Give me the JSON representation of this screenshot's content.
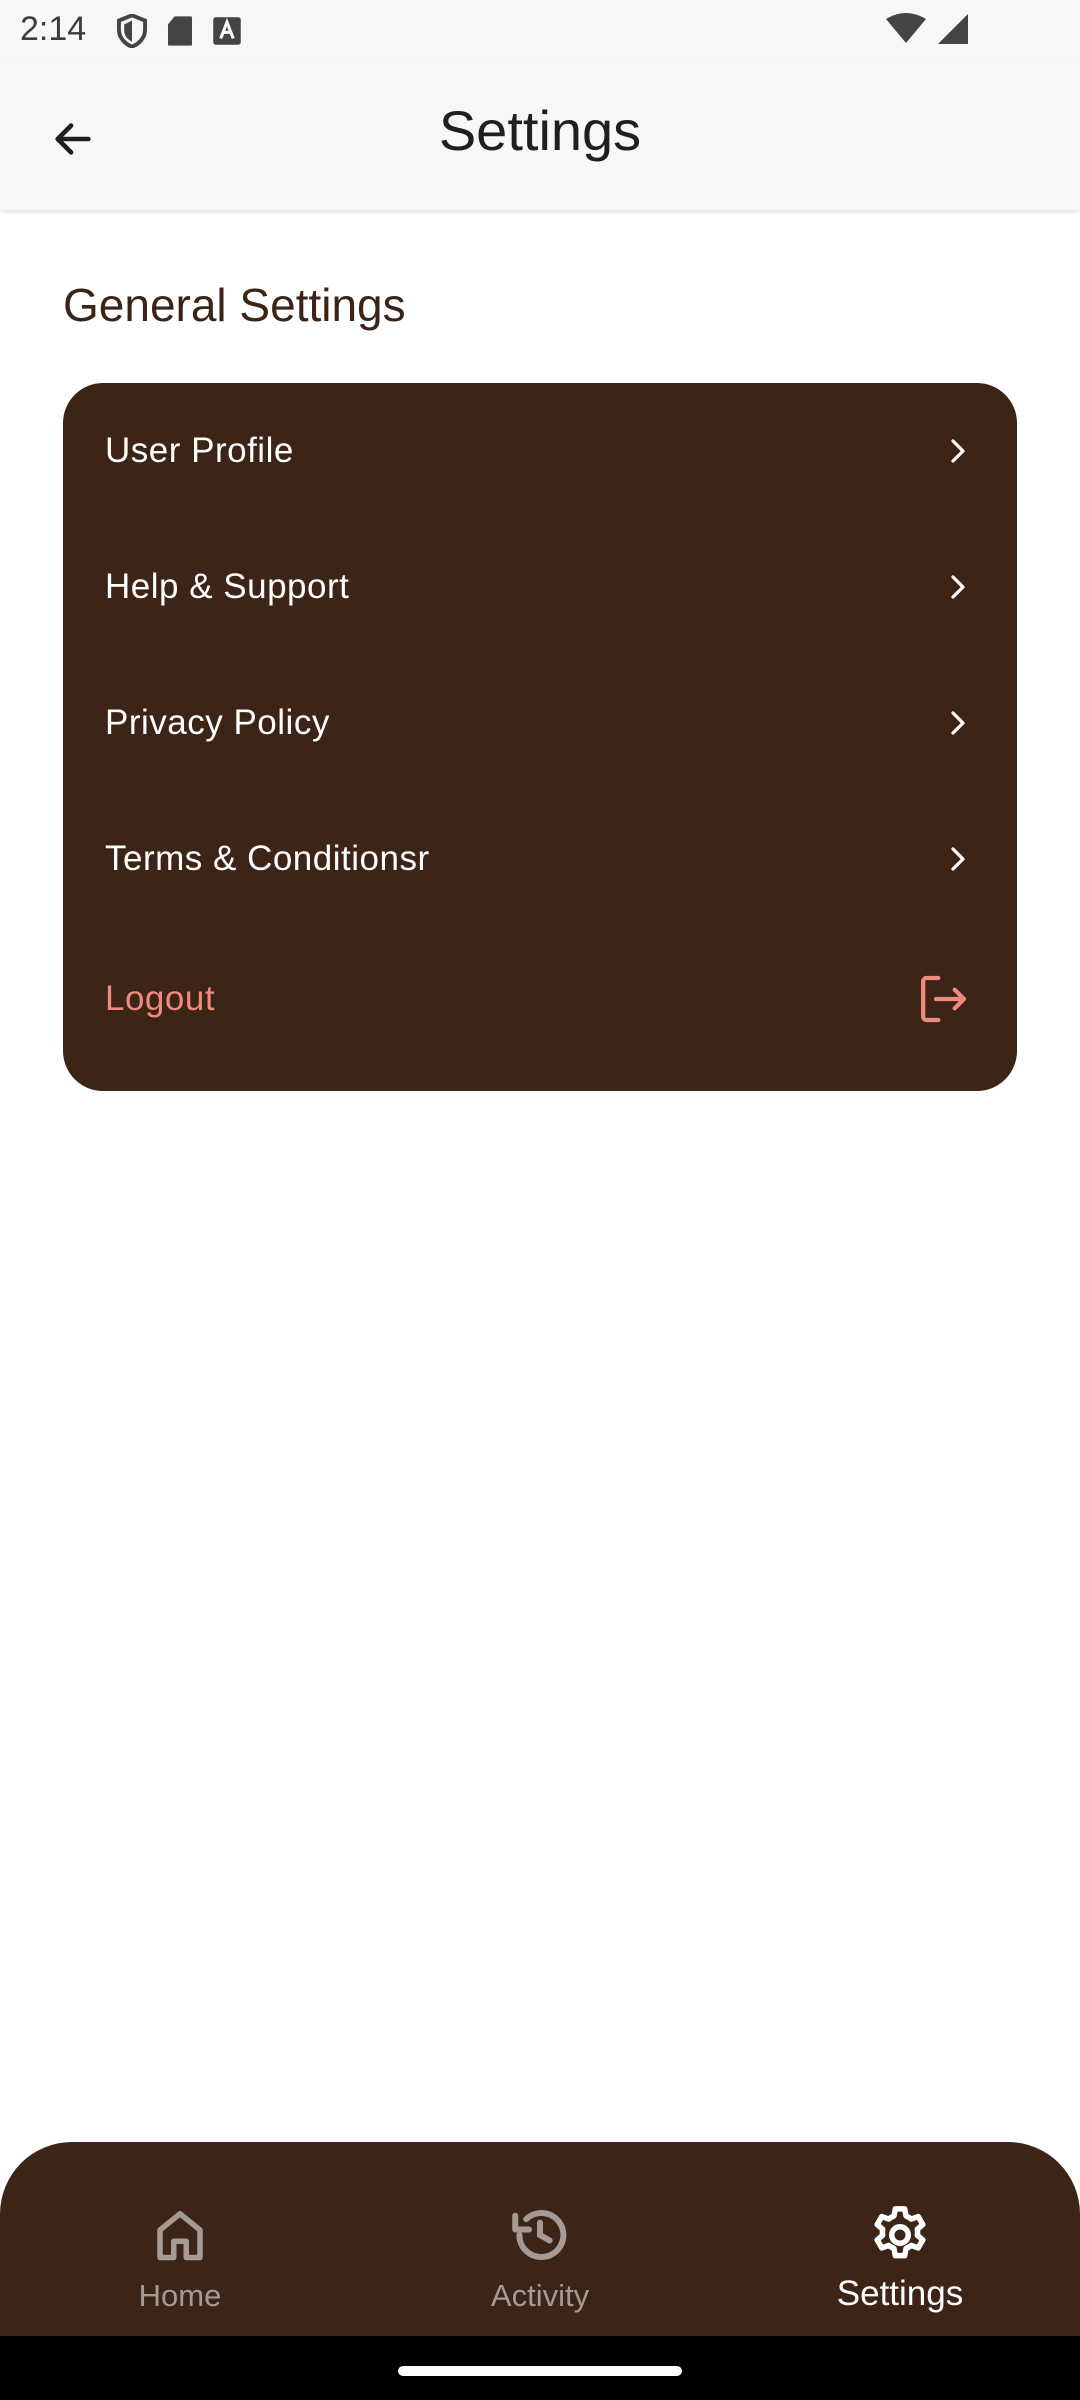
{
  "status_bar": {
    "time": "2:14"
  },
  "app_bar": {
    "title": "Settings"
  },
  "section": {
    "title": "General Settings"
  },
  "settings_items": [
    {
      "label": "User Profile"
    },
    {
      "label": "Help & Support"
    },
    {
      "label": "Privacy Policy"
    },
    {
      "label": "Terms & Conditionsr"
    }
  ],
  "logout": {
    "label": "Logout",
    "color": "#ef8a7e"
  },
  "bottom_nav": {
    "items": [
      {
        "label": "Home",
        "icon": "home-icon"
      },
      {
        "label": "Activity",
        "icon": "history-icon"
      },
      {
        "label": "Settings",
        "icon": "gear-icon",
        "active": true
      }
    ]
  },
  "colors": {
    "card": "#3c2417",
    "nav": "#3c2417",
    "header": "#f7f6f9"
  }
}
